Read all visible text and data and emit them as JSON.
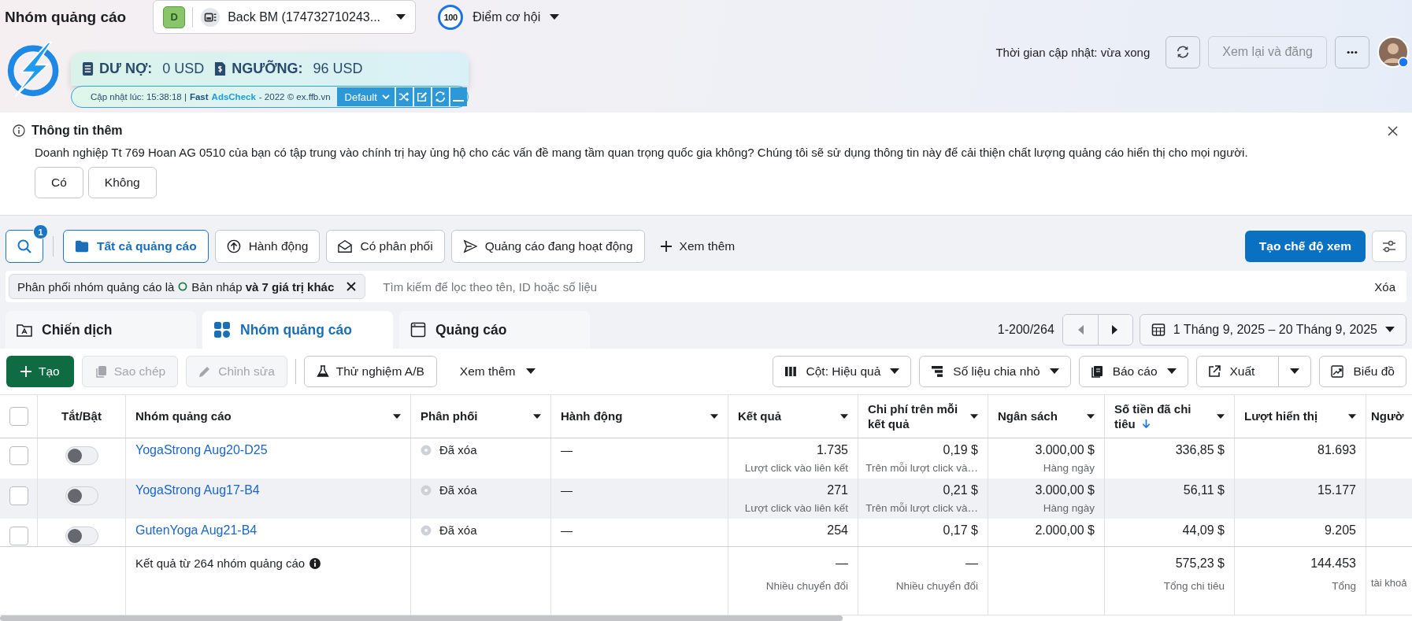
{
  "header": {
    "title": "Nhóm quảng cáo",
    "account": {
      "badge": "D",
      "name": "Back BM (174732710243..."
    },
    "score": {
      "value": "100",
      "label": "Điểm cơ hội"
    }
  },
  "extension": {
    "debt_label": "DƯ NỢ:",
    "debt_value": "0 USD",
    "threshold_label": "NGƯỠNG:",
    "threshold_value": "96 USD",
    "updated": "Cập nhật lúc: 15:38:18 |",
    "brand_1": "Fast",
    "brand_2": "AdsCheck",
    "copyright": "- 2022 © ex.ffb.vn",
    "preset": "Default"
  },
  "status": {
    "updated": "Thời gian cập nhật: vừa xong",
    "review_button": {
      "label": "Xem lại và đăng",
      "disabled": true
    }
  },
  "notice": {
    "title": "Thông tin thêm",
    "text": "Doanh nghiệp Tt 769 Hoan AG 0510 của bạn có tập trung vào chính trị hay ủng hộ cho các vấn đề mang tầm quan trọng quốc gia không? Chúng tôi sẽ sử dụng thông tin này để cải thiện chất lượng quảng cáo hiển thị cho mọi người.",
    "buttons": [
      "Có",
      "Không"
    ]
  },
  "toolbar": {
    "search_badge": "1",
    "views": [
      {
        "label": "Tất cả quảng cáo",
        "selected": true
      },
      {
        "label": "Hành động",
        "selected": false
      },
      {
        "label": "Có phân phối",
        "selected": false
      },
      {
        "label": "Quảng cáo đang hoạt động",
        "selected": false
      }
    ],
    "more": "Xem thêm",
    "create_view": "Tạo chế độ xem"
  },
  "filter_bar": {
    "chip_label": "Phân phối nhóm quảng cáo là",
    "chip_value": "Bản nháp **và 7 giá trị khác**",
    "placeholder": "Tìm kiếm để lọc theo tên, ID hoặc số liệu",
    "clear": "Xóa"
  },
  "level_tabs": [
    {
      "label": "Chiến dịch",
      "selected": false
    },
    {
      "label": "Nhóm quảng cáo",
      "selected": true
    },
    {
      "label": "Quảng cáo",
      "selected": false
    }
  ],
  "pagination": {
    "range": "1-200/264",
    "prev_disabled": true,
    "next_disabled": false
  },
  "date_range": "1 Tháng 9, 2025 – 20 Tháng 9, 2025",
  "actions": [
    {
      "label": "Tạo",
      "kind": "primary",
      "disabled": false
    },
    {
      "label": "Sao chép",
      "kind": "outline",
      "disabled": true
    },
    {
      "label": "Chỉnh sửa",
      "kind": "outline",
      "disabled": true
    },
    {
      "label": "Thử nghiệm A/B",
      "kind": "outline",
      "disabled": false
    },
    {
      "label": "Xem thêm",
      "kind": "menu",
      "disabled": false
    }
  ],
  "tools": [
    {
      "label": "Cột: Hiệu quả",
      "kind": "dropdown"
    },
    {
      "label": "Số liệu chia nhỏ",
      "kind": "dropdown"
    },
    {
      "label": "Báo cáo",
      "kind": "dropdown"
    },
    {
      "label": "Xuất",
      "kind": "split"
    },
    {
      "label": "Biểu đồ",
      "kind": "plain"
    }
  ],
  "table": {
    "all_checked": false,
    "columns": [
      {
        "label": "Tắt/Bật",
        "sortable": false,
        "sorted": false
      },
      {
        "label": "Nhóm quảng cáo",
        "sortable": true,
        "sorted": false
      },
      {
        "label": "Phân phối",
        "sortable": true,
        "sorted": false
      },
      {
        "label": "Hành động",
        "sortable": true,
        "sorted": false
      },
      {
        "label": "Kết quả",
        "sortable": true,
        "sorted": false
      },
      {
        "label": "Chi phí trên mỗi kết quả",
        "sortable": true,
        "sorted": false
      },
      {
        "label": "Ngân sách",
        "sortable": true,
        "sorted": false
      },
      {
        "label": "Số tiền đã chi tiêu",
        "sortable": true,
        "sorted": true
      },
      {
        "label": "Lượt hiển thị",
        "sortable": true,
        "sorted": false
      },
      {
        "label": "Ngườ",
        "sortable": false,
        "sorted": false
      }
    ],
    "rows": [
      {
        "checked": false,
        "on": false,
        "hovered": false,
        "name": "YogaStrong Aug20-D25",
        "delivery": "Đã xóa",
        "action": "—",
        "result": "1.735",
        "result_sub": "Lượt click vào liên kết",
        "cost": "0,19 $",
        "cost_sub": "Trên mỗi lượt click và…",
        "budget": "3.000,00 $",
        "budget_sub": "Hàng ngày",
        "spent": "336,85 $",
        "impressions": "81.693"
      },
      {
        "checked": false,
        "on": false,
        "hovered": true,
        "name": "YogaStrong Aug17-B4",
        "delivery": "Đã xóa",
        "action": "—",
        "result": "271",
        "result_sub": "Lượt click vào liên kết",
        "cost": "0,21 $",
        "cost_sub": "Trên mỗi lượt click và…",
        "budget": "3.000,00 $",
        "budget_sub": "Hàng ngày",
        "spent": "56,11 $",
        "impressions": "15.177"
      },
      {
        "checked": false,
        "on": false,
        "hovered": false,
        "name": "GutenYoga Aug21-B4",
        "delivery": "Đã xóa",
        "action": "—",
        "result": "254",
        "cost": "0,17 $",
        "budget": "2.000,00 $",
        "spent": "44,09 $",
        "impressions": "9.205"
      }
    ],
    "footer": {
      "label": "Kết quả từ 264 nhóm quảng cáo",
      "result": "—",
      "result_sub": "Nhiều chuyển đổi",
      "cost": "—",
      "cost_sub": "Nhiều chuyển đổi",
      "spent": "575,23 $",
      "spent_sub": "Tổng chi tiêu",
      "impressions": "144.453",
      "impressions_sub": "Tổng",
      "extra": "tài khoả"
    }
  }
}
